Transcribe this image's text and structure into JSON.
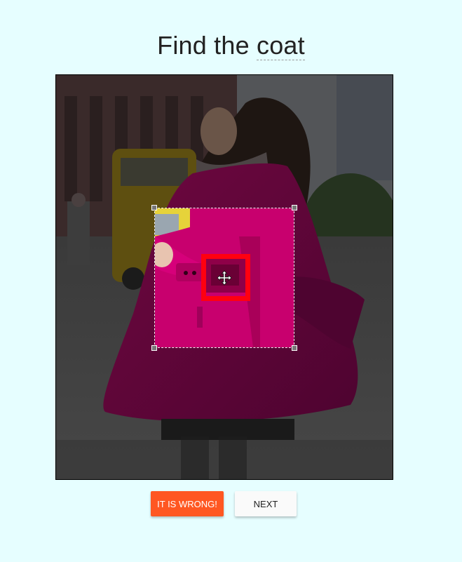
{
  "header": {
    "prefix": "Find the",
    "object": "coat"
  },
  "actions": {
    "wrong_label": "IT IS WRONG!",
    "next_label": "NEXT"
  },
  "colors": {
    "page_background": "#e6feff",
    "target_box": "#ff0010",
    "wrong_button": "#ff5722",
    "next_button": "#fafafa",
    "coat": "#c8006e"
  },
  "icons": {
    "crop_handle": "move-icon"
  }
}
